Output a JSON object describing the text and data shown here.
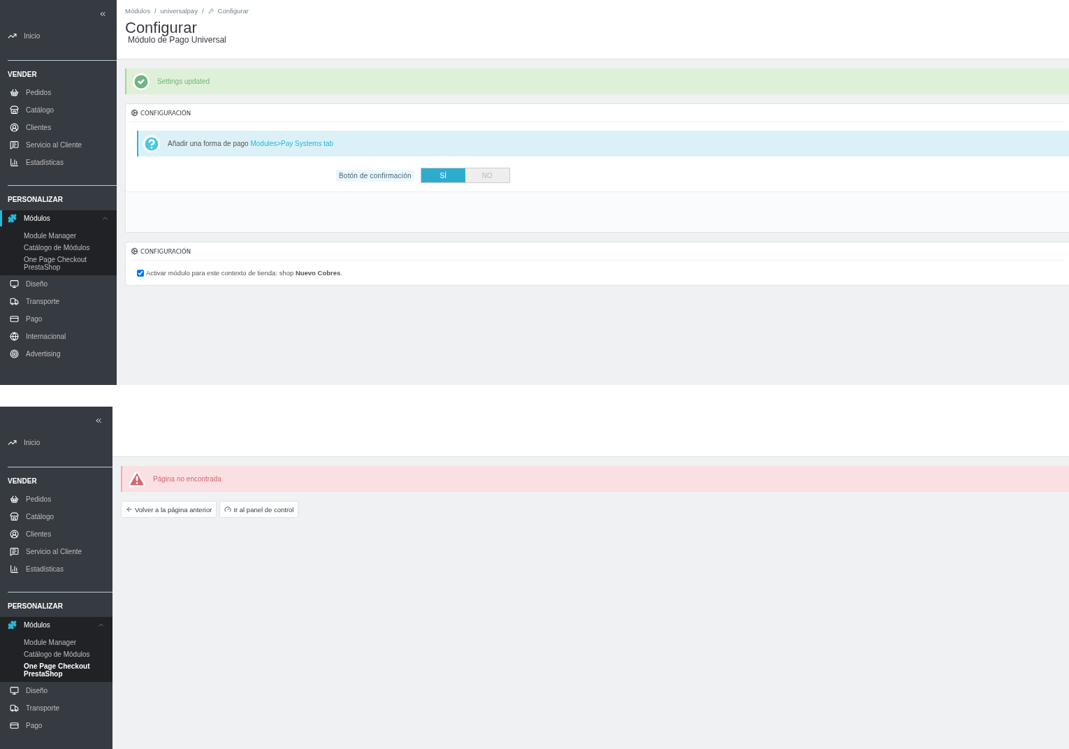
{
  "screens": [
    {
      "sidebar": {
        "home": {
          "label": "Inicio"
        },
        "sections": [
          {
            "title": "VENDER",
            "items": [
              {
                "label": "Pedidos"
              },
              {
                "label": "Catálogo"
              },
              {
                "label": "Clientes"
              },
              {
                "label": "Servicio al Cliente"
              },
              {
                "label": "Estadísticas"
              }
            ]
          },
          {
            "title": "PERSONALIZAR",
            "items": [
              {
                "label": "Módulos",
                "selected": true,
                "expanded": true,
                "children": [
                  {
                    "label": "Module Manager",
                    "selected": false
                  },
                  {
                    "label": "Catálogo de Módulos",
                    "selected": false
                  },
                  {
                    "label": "One Page Checkout PrestaShop",
                    "selected": false
                  }
                ]
              },
              {
                "label": "Diseño"
              },
              {
                "label": "Transporte"
              },
              {
                "label": "Pago"
              },
              {
                "label": "Internacional"
              },
              {
                "label": "Advertising"
              }
            ]
          }
        ]
      },
      "header": {
        "breadcrumb": [
          {
            "kind": "link",
            "label": "Módulos"
          },
          {
            "kind": "separator",
            "label": "/"
          },
          {
            "kind": "link",
            "label": "universalpay"
          },
          {
            "kind": "separator",
            "label": "/"
          },
          {
            "kind": "current",
            "label": "Configurar"
          }
        ],
        "title": "Configurar",
        "subtitle": "Módulo de Pago Universal"
      },
      "alert": {
        "kind": "success",
        "text": "Settings updated"
      },
      "cards": [
        {
          "title": "CONFIGURACIÓN",
          "info": {
            "text": "Añadir una forma de pago",
            "link": "Modules>Pay Systems tab"
          },
          "switch": {
            "label": "Botón de confirmación",
            "options": [
              {
                "label": "SÍ",
                "selected": true
              },
              {
                "label": "NO",
                "selected": false
              }
            ]
          },
          "footer": true
        },
        {
          "title": "CONFIGURACIÓN",
          "checkbox": {
            "label": "Activar módulo para este contexto de tienda: shop **Nuevo Cobres**.",
            "checked": true
          }
        }
      ]
    },
    {
      "sidebar": {
        "home": {
          "label": "Inicio"
        },
        "sections": [
          {
            "title": "VENDER",
            "items": [
              {
                "label": "Pedidos"
              },
              {
                "label": "Catálogo"
              },
              {
                "label": "Clientes"
              },
              {
                "label": "Servicio al Cliente"
              },
              {
                "label": "Estadísticas"
              }
            ]
          },
          {
            "title": "PERSONALIZAR",
            "items": [
              {
                "label": "Módulos",
                "selected": false,
                "expanded": true,
                "children": [
                  {
                    "label": "Module Manager",
                    "selected": false
                  },
                  {
                    "label": "Catálogo de Módulos",
                    "selected": false
                  },
                  {
                    "label": "One Page Checkout PrestaShop",
                    "selected": true
                  }
                ]
              },
              {
                "label": "Diseño"
              },
              {
                "label": "Transporte"
              },
              {
                "label": "Pago"
              }
            ]
          }
        ]
      },
      "alert": {
        "kind": "danger",
        "text": "Página no encontrada"
      },
      "buttons": [
        {
          "kind": "back",
          "label": "Volver a la página anterior"
        },
        {
          "kind": "dashboard",
          "label": "Ir al panel de control"
        }
      ]
    }
  ]
}
